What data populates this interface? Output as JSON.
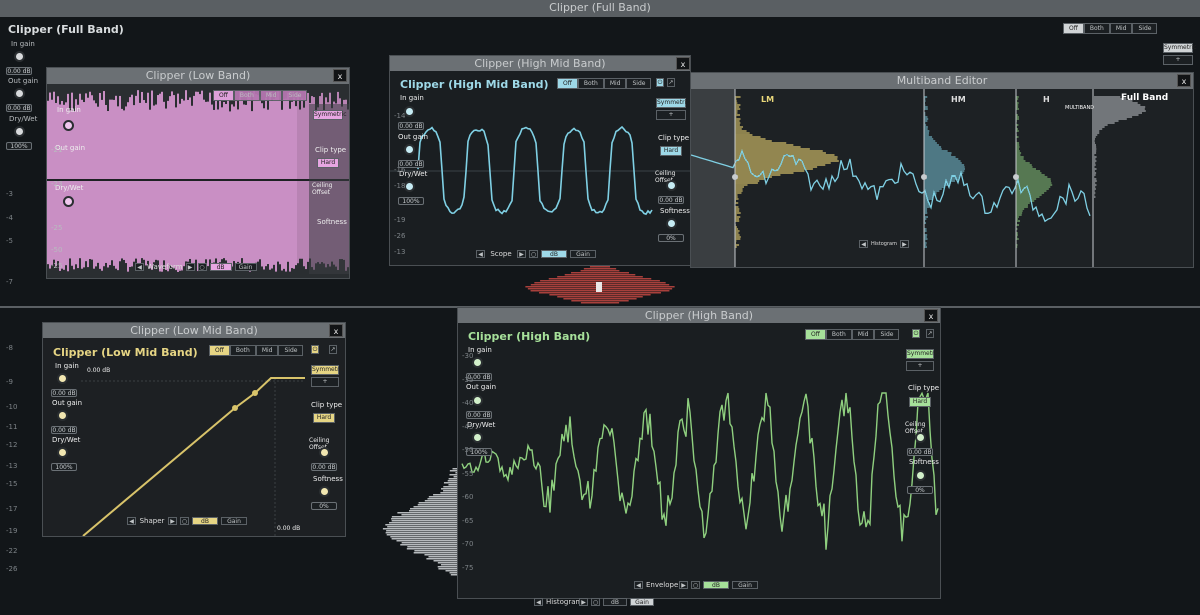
{
  "full_band": {
    "titlebar": "Clipper (Full Band)",
    "title": "Clipper (Full Band)",
    "in_gain_label": "In gain",
    "in_gain_value": "0.00 dB",
    "out_gain_label": "Out gain",
    "out_gain_value": "0.00 dB",
    "drywet_label": "Dry/Wet",
    "drywet_value": "100%",
    "mode_buttons": [
      "Off",
      "Both",
      "Mid",
      "Side"
    ],
    "symmetric_label": "Symmetric",
    "plus_label": "+",
    "scale_ticks": [
      "-3",
      "-4",
      "-5",
      "-7",
      "-8",
      "-9",
      "-10",
      "-11",
      "-12",
      "-13",
      "-15",
      "-17",
      "-19",
      "-22",
      "-26"
    ]
  },
  "low_band": {
    "titlebar": "Clipper (Low Band)",
    "in_gain_label": "In gain",
    "out_gain_label": "Out gain",
    "drywet_label": "Dry/Wet",
    "symmetric_label": "Symmetric",
    "clip_type_label": "Clip type",
    "hard_label": "Hard",
    "ceiling_label": "Ceiling Offset",
    "softness_label": "Softness",
    "mode_buttons": [
      "Off",
      "Both",
      "Mid",
      "Side"
    ],
    "ticks": [
      "-21",
      "-23",
      "-25",
      "-50",
      "-25"
    ],
    "scope_label": "Waveform",
    "unit_buttons": [
      "dB",
      "Gain"
    ]
  },
  "high_mid_band": {
    "titlebar": "Clipper (High Mid Band)",
    "title": "Clipper (High Mid Band)",
    "in_gain_label": "In gain",
    "in_gain_value": "0.00 dB",
    "out_gain_label": "Out gain",
    "out_gain_value": "0.00 dB",
    "drywet_label": "Dry/Wet",
    "drywet_value": "100%",
    "symmetric_label": "Symmetric",
    "plus_label": "+",
    "clip_type_label": "Clip type",
    "hard_label": "Hard",
    "ceiling_label": "Ceiling Offset",
    "ceiling_value": "0.00 dB",
    "softness_label": "Softness",
    "softness_value": "0%",
    "mode_buttons": [
      "Off",
      "Both",
      "Mid",
      "Side"
    ],
    "ticks": [
      "-14",
      "-16",
      "-18",
      "-19",
      "-26",
      "-13"
    ],
    "scope_label": "Scope",
    "unit_buttons": [
      "dB",
      "Gain"
    ]
  },
  "multiband": {
    "titlebar": "Multiband Editor",
    "bands": [
      "LM",
      "HM",
      "H",
      "Full Band"
    ],
    "multiband_tag": "MULTIBAND",
    "histogram_label": "Histogram"
  },
  "low_mid_band": {
    "titlebar": "Clipper (Low Mid Band)",
    "title": "Clipper (Low Mid Band)",
    "in_gain_label": "In gain",
    "in_gain_value": "0.00 dB",
    "out_gain_label": "Out gain",
    "out_gain_value": "0.00 dB",
    "drywet_label": "Dry/Wet",
    "drywet_value": "100%",
    "symmetric_label": "Symmetric",
    "plus_label": "+",
    "clip_type_label": "Clip type",
    "hard_label": "Hard",
    "ceiling_label": "Ceiling Offset",
    "ceiling_value": "0.00 dB",
    "softness_label": "Softness",
    "softness_value": "0%",
    "mode_buttons": [
      "Off",
      "Both",
      "Mid",
      "Side"
    ],
    "top_db": "0.00 dB",
    "bottom_db": "0.00 dB",
    "scope_label": "Shaper",
    "unit_buttons": [
      "dB",
      "Gain"
    ]
  },
  "high_band": {
    "titlebar": "Clipper (High Band)",
    "title": "Clipper (High Band)",
    "in_gain_label": "In gain",
    "in_gain_value": "0.00 dB",
    "out_gain_label": "Out gain",
    "out_gain_value": "0.00 dB",
    "drywet_label": "Dry/Wet",
    "drywet_value": "100%",
    "symmetric_label": "Symmetric",
    "plus_label": "+",
    "clip_type_label": "Clip type",
    "hard_label": "Hard",
    "ceiling_label": "Ceiling Offset",
    "ceiling_value": "0.00 dB",
    "softness_label": "Softness",
    "softness_value": "0%",
    "mode_buttons": [
      "Off",
      "Both",
      "Mid",
      "Side"
    ],
    "ticks": [
      "-30",
      "-35",
      "-40",
      "-45",
      "-50",
      "-55",
      "-60",
      "-65",
      "-70",
      "-75"
    ],
    "scope_label": "Envelope",
    "unit_buttons": [
      "dB",
      "Gain"
    ]
  },
  "bottom_bar": {
    "scope_label": "Histogram",
    "unit_buttons": [
      "dB",
      "Gain"
    ]
  },
  "colors": {
    "pink": "#d78fd0",
    "cyan": "#7fd0e4",
    "gold": "#d8c36a",
    "green": "#8fd07f"
  }
}
